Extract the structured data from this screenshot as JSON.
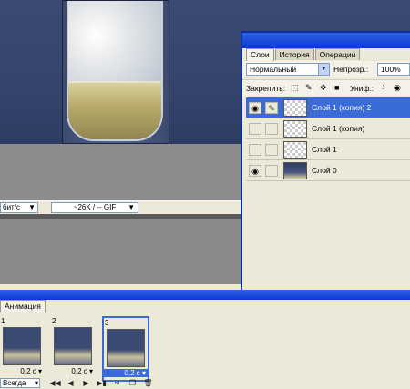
{
  "status": {
    "speed": "бит/с",
    "size_format": "~26K / -- GIF"
  },
  "layers_panel": {
    "tabs": [
      "Слои",
      "История",
      "Операции"
    ],
    "blend_mode": "Нормальный",
    "opacity_label": "Непрозр.:",
    "opacity_value": "100%",
    "lock_label": "Закрепить:",
    "fill_label": "Униф.:",
    "layers": [
      {
        "name": "Слой 1 (копия) 2",
        "visible": true,
        "selected": true,
        "thumb": "transparent"
      },
      {
        "name": "Слой 1 (копия)",
        "visible": false,
        "selected": false,
        "thumb": "transparent"
      },
      {
        "name": "Слой 1",
        "visible": false,
        "selected": false,
        "thumb": "transparent"
      },
      {
        "name": "Слой 0",
        "visible": true,
        "selected": false,
        "thumb": "photo"
      }
    ]
  },
  "animation": {
    "tab_label": "Анимация",
    "frames": [
      {
        "number": "1",
        "delay": "0,2 c"
      },
      {
        "number": "2",
        "delay": "0,2 c"
      },
      {
        "number": "3",
        "delay": "0,2 c"
      }
    ],
    "loop": "Всегда"
  },
  "colors": {
    "selection": "#3a6bd6",
    "titlebar": "#0a3ad2"
  }
}
